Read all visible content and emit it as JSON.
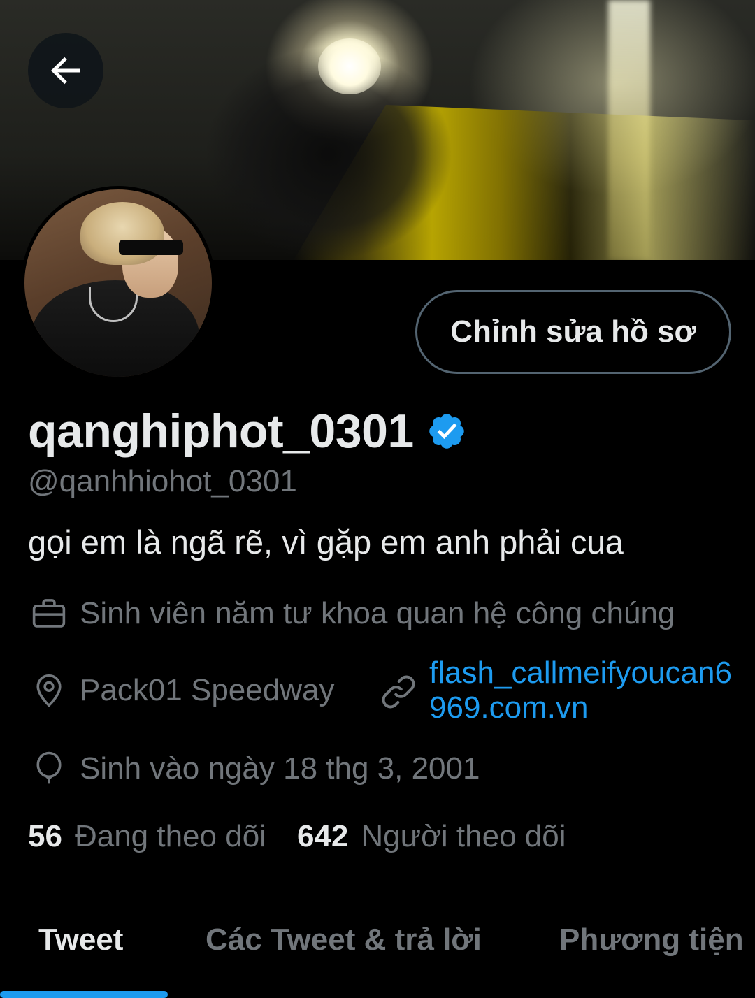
{
  "header": {
    "back_label": "Back"
  },
  "profile": {
    "display_name": "qanghiphot_0301",
    "verified": true,
    "handle": "@qanhhiohot_0301",
    "bio": "gọi em là ngã rẽ, vì gặp em anh phải cua",
    "edit_button_label": "Chỉnh sửa hồ sơ",
    "job": "Sinh viên năm tư khoa quan hệ công chúng",
    "location": "Pack01 Speedway",
    "website": "flash_callmeifyoucan6969.com.vn",
    "birthday": "Sinh vào ngày 18 thg 3, 2001",
    "following_count": "56",
    "following_label": "Đang theo dõi",
    "followers_count": "642",
    "followers_label": "Người theo dõi"
  },
  "tabs": [
    {
      "label": "Tweet",
      "active": true
    },
    {
      "label": "Các Tweet & trả lời",
      "active": false
    },
    {
      "label": "Phương tiện",
      "active": false
    }
  ],
  "colors": {
    "background": "#000000",
    "accent": "#1d9bf0",
    "muted_text": "#71767b",
    "primary_text": "#e7e9ea",
    "button_border": "#536471"
  },
  "icons": {
    "back": "arrow-left-icon",
    "verified": "verified-badge-icon",
    "job": "briefcase-icon",
    "location": "map-pin-icon",
    "website": "link-icon",
    "birthday": "balloon-icon"
  }
}
